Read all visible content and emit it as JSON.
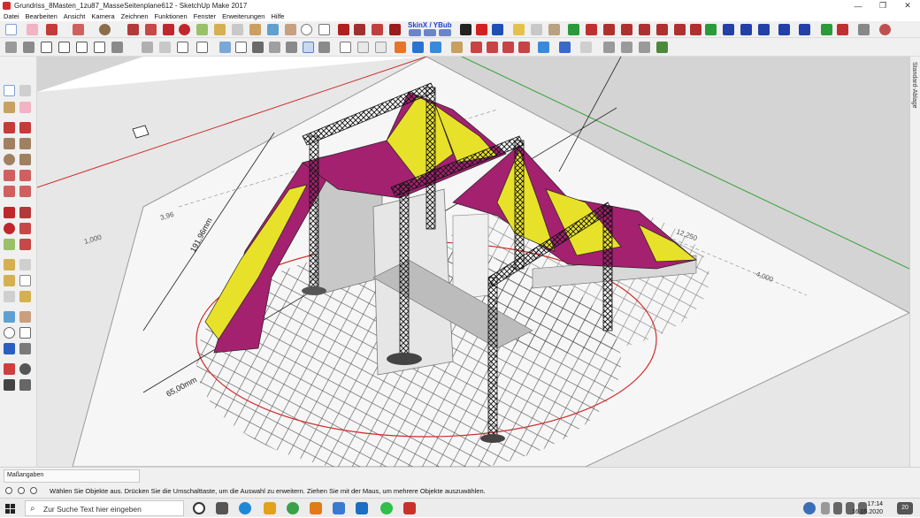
{
  "window": {
    "title": "Grundriss_8Masten_1zu87_MasseSeitenplane612 - SketchUp Make 2017",
    "minimize": "—",
    "maximize": "❐",
    "close": "✕"
  },
  "menu": [
    "Datei",
    "Bearbeiten",
    "Ansicht",
    "Kamera",
    "Zeichnen",
    "Funktionen",
    "Fenster",
    "Erweiterungen",
    "Hilfe"
  ],
  "toolbar": {
    "skin_label": "SkinX / YBub"
  },
  "viewport": {
    "dimensions": [
      "191,96mm",
      "65,00mm",
      "3,96",
      "12,250",
      "4,000",
      "1,000"
    ],
    "colors": {
      "canopy_purple": "#a3216f",
      "canopy_yellow": "#e8e12a",
      "axis_red": "#d12a2a",
      "axis_green": "#2a9a2a"
    }
  },
  "right_panel": {
    "label": "Standard-Ablage"
  },
  "measure": {
    "label": "Maßangaben"
  },
  "status": {
    "text": "Wählen Sie Objekte aus. Drücken Sie die Umschalttaste, um die Auswahl zu erweitern. Ziehen Sie mit der Maus, um mehrere Objekte auszuwählen."
  },
  "taskbar": {
    "search_placeholder": "Zur Suche Text hier eingeben",
    "time": "17:14",
    "date": "16.05.2020",
    "notification_count": "20"
  }
}
